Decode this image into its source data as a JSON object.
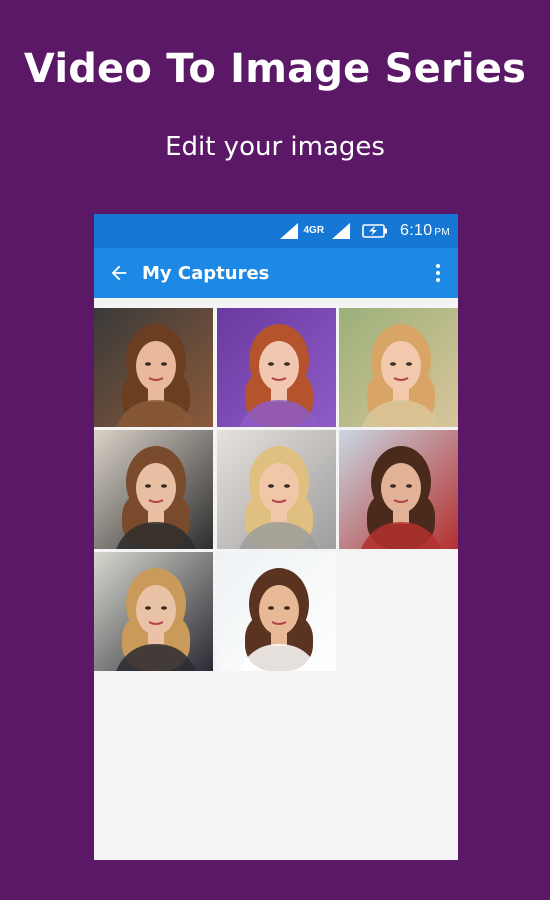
{
  "promo": {
    "title": "Video To Image Series",
    "subtitle": "Edit your images"
  },
  "status_bar": {
    "network": "4G",
    "network_suffix": "R",
    "time": "6:10",
    "ampm": "PM"
  },
  "app_bar": {
    "title": "My Captures",
    "back_icon": "arrow-left-icon",
    "menu_icon": "more-vert-icon"
  },
  "colors": {
    "background": "#5a1866",
    "status_bar": "#1677d4",
    "app_bar": "#1e88e5",
    "content_bg": "#f4f4f4"
  },
  "captures": [
    {
      "name": "capture-1",
      "bg": "#3a3a3a",
      "accent": "#8a5a3a",
      "skin": "#e8b99a",
      "hair": "#6b3e22"
    },
    {
      "name": "capture-2",
      "bg": "#6a3aa0",
      "accent": "#8e5cc7",
      "skin": "#f1c7b1",
      "hair": "#b5532d"
    },
    {
      "name": "capture-3",
      "bg": "#9bb07a",
      "accent": "#d8c59a",
      "skin": "#f2c9ad",
      "hair": "#d9a566"
    },
    {
      "name": "capture-4",
      "bg": "#d9d2c8",
      "accent": "#2d2d2d",
      "skin": "#e9bfa3",
      "hair": "#7a4a2c"
    },
    {
      "name": "capture-5",
      "bg": "#e6e1dc",
      "accent": "#9e9e9e",
      "skin": "#f0c8a8",
      "hair": "#e0c080"
    },
    {
      "name": "capture-6",
      "bg": "#c9d6e2",
      "accent": "#b3302e",
      "skin": "#e2b296",
      "hair": "#4a2a1a"
    },
    {
      "name": "capture-7",
      "bg": "#d8d8d0",
      "accent": "#2a2a33",
      "skin": "#eac3a6",
      "hair": "#c99a5a"
    },
    {
      "name": "capture-8",
      "bg": "#eef2f4",
      "accent": "#ffffff",
      "skin": "#e7b996",
      "hair": "#5a3420"
    }
  ]
}
